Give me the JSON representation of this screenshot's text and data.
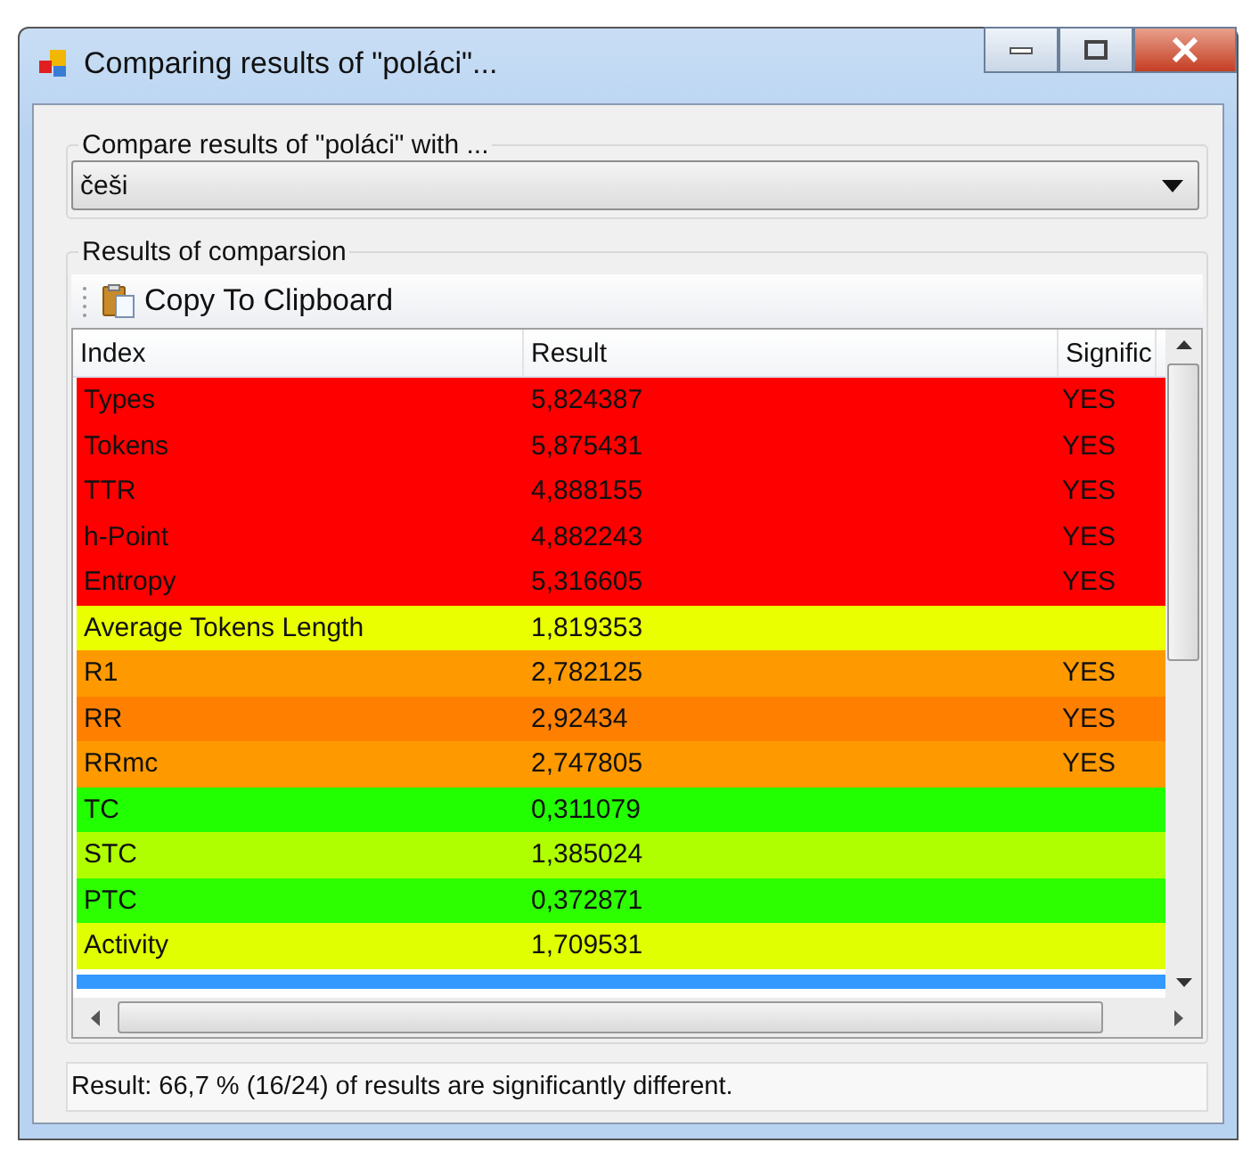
{
  "window": {
    "title": "Comparing results of \"poláci\"..."
  },
  "compare_group": {
    "title": "Compare results of \"poláci\" with ...",
    "dropdown": {
      "value": "češi"
    }
  },
  "results_group": {
    "title": "Results of comparsion",
    "toolbar": {
      "button": "Copy To Clipboard"
    }
  },
  "table": {
    "columns": [
      "Index",
      "Result",
      "Signific"
    ],
    "rows": [
      {
        "index": "Types",
        "result": "5,824387",
        "significant": "YES",
        "color": "#ff0000"
      },
      {
        "index": "Tokens",
        "result": "5,875431",
        "significant": "YES",
        "color": "#ff0000"
      },
      {
        "index": "TTR",
        "result": "4,888155",
        "significant": "YES",
        "color": "#ff0000"
      },
      {
        "index": "h-Point",
        "result": "4,882243",
        "significant": "YES",
        "color": "#ff0000"
      },
      {
        "index": "Entropy",
        "result": "5,316605",
        "significant": "YES",
        "color": "#ff0000"
      },
      {
        "index": "Average Tokens Length",
        "result": "1,819353",
        "color": "#eaff00"
      },
      {
        "index": "R1",
        "result": "2,782125",
        "significant": "YES",
        "color": "#ff9900"
      },
      {
        "index": "RR",
        "result": "2,92434",
        "significant": "YES",
        "color": "#ff8000"
      },
      {
        "index": "RRmc",
        "result": "2,747805",
        "significant": "YES",
        "color": "#ff9900"
      },
      {
        "index": "TC",
        "result": "0,311079",
        "color": "#22ff00"
      },
      {
        "index": "STC",
        "result": "1,385024",
        "color": "#b0ff00"
      },
      {
        "index": "PTC",
        "result": "0,372871",
        "color": "#2dff00"
      },
      {
        "index": "Activity",
        "result": "1,709531",
        "color": "#e0ff00"
      },
      {
        "color": "#3399ff"
      }
    ]
  },
  "status_bar": "Result: 66,7 % (16/24) of results are significantly different."
}
